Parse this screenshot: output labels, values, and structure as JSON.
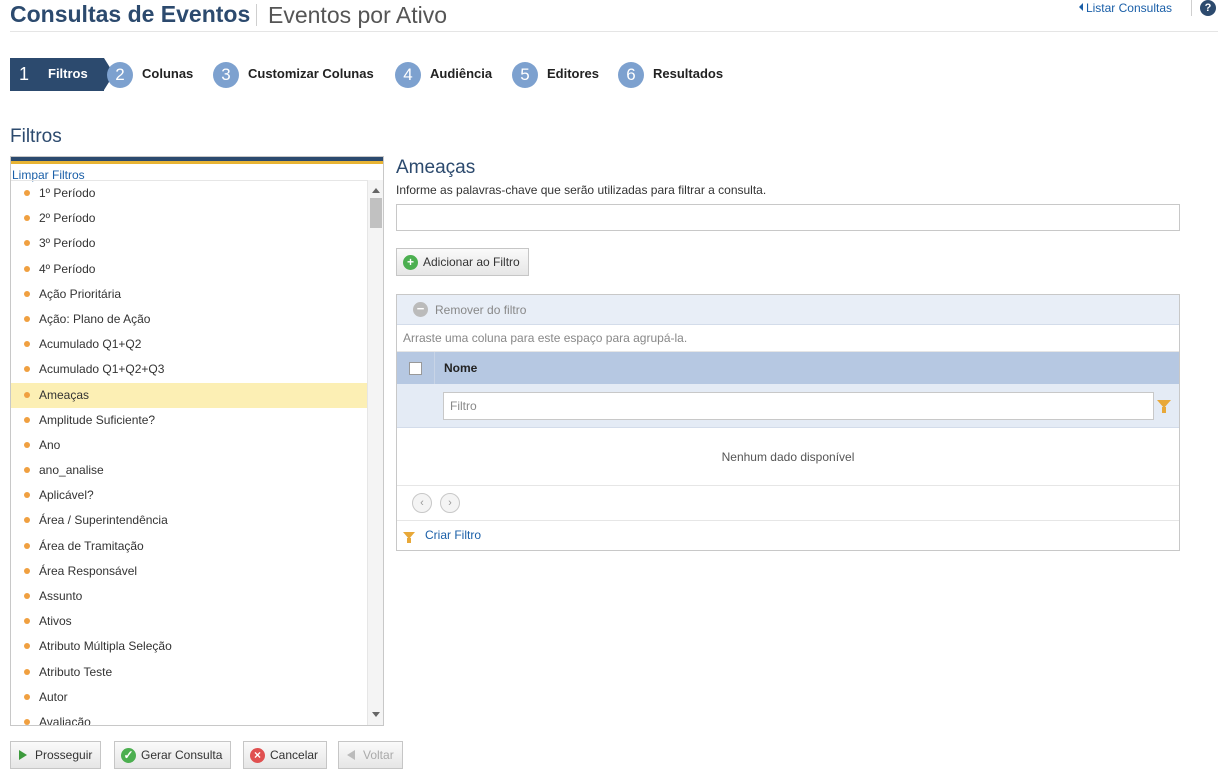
{
  "header": {
    "title": "Consultas de Eventos",
    "subtitle": "Eventos por Ativo",
    "list_link": "Listar Consultas",
    "help_label": "?"
  },
  "steps": [
    {
      "num": "1",
      "label": "Filtros",
      "active": true
    },
    {
      "num": "2",
      "label": "Colunas"
    },
    {
      "num": "3",
      "label": "Customizar Colunas"
    },
    {
      "num": "4",
      "label": "Audiência"
    },
    {
      "num": "5",
      "label": "Editores"
    },
    {
      "num": "6",
      "label": "Resultados"
    }
  ],
  "section_title": "Filtros",
  "left_panel": {
    "clear_label": "Limpar Filtros",
    "items": [
      "1º Período",
      "2º Período",
      "3º Período",
      "4º Período",
      "Ação Prioritária",
      "Ação: Plano de Ação",
      "Acumulado Q1+Q2",
      "Acumulado Q1+Q2+Q3",
      "Ameaças",
      "Amplitude Suficiente?",
      "Ano",
      "ano_analise",
      "Aplicável?",
      "Área / Superintendência",
      "Área de Tramitação",
      "Área Responsável",
      "Assunto",
      "Ativos",
      "Atributo Múltipla Seleção",
      "Atributo Teste",
      "Autor",
      "Avaliação"
    ],
    "selected_index": 8
  },
  "right_panel": {
    "title": "Ameaças",
    "description": "Informe as palavras-chave que serão utilizadas para filtrar a consulta.",
    "keyword_value": "",
    "add_button": "Adicionar ao Filtro",
    "grid": {
      "remove_label": "Remover do filtro",
      "group_hint": "Arraste uma coluna para este espaço para agrupá-la.",
      "column_name": "Nome",
      "filter_placeholder": "Filtro",
      "empty_message": "Nenhum dado disponível",
      "create_filter": "Criar Filtro"
    }
  },
  "bottom_buttons": {
    "prosseguir": "Prosseguir",
    "gerar": "Gerar Consulta",
    "cancelar": "Cancelar",
    "voltar": "Voltar"
  },
  "colors": {
    "primary": "#2c4a6e",
    "step_circle": "#7da1cf",
    "accent_bar": "#e8b434",
    "selected_row": "#fcefb4",
    "link": "#1a5fa8"
  },
  "icons": {
    "help": "help-icon",
    "bullet": "bullet-icon",
    "add": "add-circle-icon",
    "remove": "minus-circle-icon",
    "filter": "funnel-icon"
  }
}
